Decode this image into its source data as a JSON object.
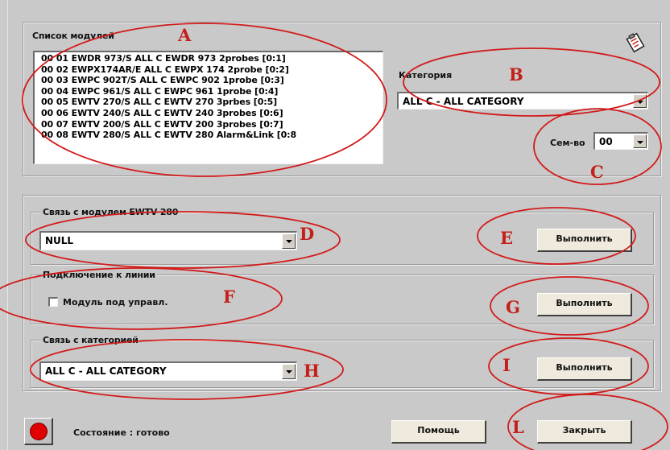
{
  "modules_group": {
    "title": "Список модулей",
    "items": [
      "00 01 EWDR  973/S ALL C EWDR 973 2probes [0:1]",
      "00 02 EWPX174AR/E ALL C EWPX 174 2probe [0:2]",
      "00 03 EWPC 902T/S ALL C EWPC 902 1probe [0:3]",
      "00 04 EWPC  961/S ALL C EWPC 961 1probe [0:4]",
      "00 05 EWTV  270/S ALL C EWTV 270 3prbes [0:5]",
      "00 06 EWTV  240/S ALL C EWTV 240 3probes [0:6]",
      "00 07 EWTV  200/S ALL C EWTV 200 3probes [0:7]",
      "00 08 EWTV  280/S ALL C EWTV 280 Alarm&Link [0:8"
    ]
  },
  "category": {
    "label": "Категория",
    "value": "ALL C - ALL CATEGORY"
  },
  "family": {
    "label": "Сем-во",
    "value": "00"
  },
  "connect_module": {
    "title": "Связь с модулем EWTV 280",
    "value": "NULL",
    "button": "Выполнить"
  },
  "line_connect": {
    "title": "Подключение к линии",
    "checkbox_label": "Модуль под управл.",
    "checked": false,
    "button": "Выполнить"
  },
  "connect_category": {
    "title": "Связь с категорией",
    "value": "ALL C - ALL CATEGORY",
    "button": "Выполнить"
  },
  "status": {
    "text": "Состояние : готово",
    "color": "#e00000"
  },
  "help_button": "Помощь",
  "close_button": "Закрыть",
  "annotations": {
    "a": "A",
    "b": "B",
    "c": "C",
    "d": "D",
    "e": "E",
    "f": "F",
    "g": "G",
    "h": "H",
    "i": "I",
    "l": "L"
  },
  "colors": {
    "annotation": "#c4201a",
    "background": "#c9c9c9"
  }
}
